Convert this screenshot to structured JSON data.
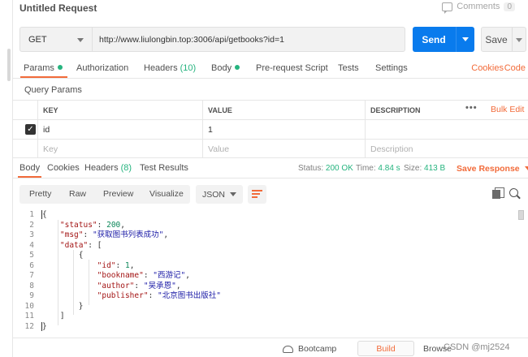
{
  "title": "Untitled Request",
  "comments": {
    "label": "Comments",
    "count": "0"
  },
  "request": {
    "method": "GET",
    "url": "http://www.liulongbin.top:3006/api/getbooks?id=1",
    "send_label": "Send",
    "save_label": "Save"
  },
  "request_tabs": {
    "params": "Params",
    "authorization": "Authorization",
    "headers": "Headers",
    "headers_count": "(10)",
    "body": "Body",
    "prerequest": "Pre-request Script",
    "tests": "Tests",
    "settings": "Settings",
    "cookies": "Cookies",
    "code": "Code"
  },
  "query_params": {
    "title": "Query Params",
    "columns": {
      "key": "KEY",
      "value": "VALUE",
      "description": "DESCRIPTION"
    },
    "bulk_edit": "Bulk Edit",
    "more": "•••",
    "rows": [
      {
        "key": "id",
        "value": "1",
        "description": ""
      }
    ],
    "placeholders": {
      "key": "Key",
      "value": "Value",
      "description": "Description"
    }
  },
  "response_tabs": {
    "body": "Body",
    "cookies": "Cookies",
    "headers": "Headers",
    "headers_count": "(8)",
    "test_results": "Test Results"
  },
  "response_meta": {
    "status_label": "Status:",
    "status_value": "200 OK",
    "time_label": "Time:",
    "time_value": "4.84 s",
    "size_label": "Size:",
    "size_value": "413 B",
    "save_response": "Save Response"
  },
  "viewer": {
    "modes": [
      "Pretty",
      "Raw",
      "Preview",
      "Visualize"
    ],
    "format": "JSON"
  },
  "response_body": {
    "line_numbers": [
      "1",
      "2",
      "3",
      "4",
      "5",
      "6",
      "7",
      "8",
      "9",
      "10",
      "11",
      "12"
    ],
    "status_key": "\"status\"",
    "status_value": "200",
    "msg_key": "\"msg\"",
    "msg_value": "\"获取图书列表成功\"",
    "data_key": "\"data\"",
    "id_key": "\"id\"",
    "id_value": "1",
    "bookname_key": "\"bookname\"",
    "bookname_value": "\"西游记\"",
    "author_key": "\"author\"",
    "author_value": "\"吴承恩\"",
    "publisher_key": "\"publisher\"",
    "publisher_value": "\"北京图书出版社\""
  },
  "footer": {
    "bootcamp": "Bootcamp",
    "build": "Build",
    "browse": "Browse",
    "watermark": "CSDN @mj2524"
  },
  "colors": {
    "accent": "#f26b3a",
    "send": "#097bed",
    "success": "#26b47f"
  },
  "icons": [
    "comment-icon",
    "chevron-down-icon",
    "checkbox-icon",
    "more-icon",
    "wrap-lines-icon",
    "copy-icon",
    "search-icon",
    "bootcamp-icon"
  ]
}
